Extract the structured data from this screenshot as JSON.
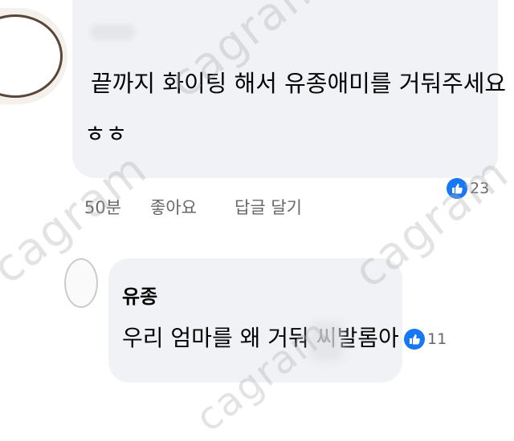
{
  "comment": {
    "text_line1": "끝까지 화이팅 해서 유종애미를 거둬주세요",
    "text_line2": "ㅎㅎ",
    "time": "50분",
    "like_label": "좋아요",
    "reply_label": "답글 달기",
    "like_count": "23"
  },
  "reply": {
    "author": "유종",
    "text": "우리 엄마를 왜 거둬 씨발롬아",
    "like_count": "11"
  },
  "watermark": {
    "text": "cagram",
    "color": "#b0b0b0"
  },
  "colors": {
    "bubble": "#f0f2f5",
    "like_blue": "#1877f2",
    "meta_gray": "#65676b"
  }
}
